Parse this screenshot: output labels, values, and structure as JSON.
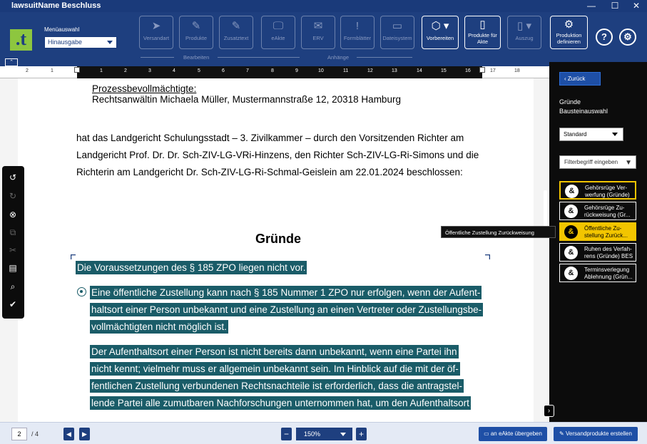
{
  "window": {
    "title": "lawsuitName Beschluss",
    "minimize": "—",
    "maximize": "☐",
    "close": "✕"
  },
  "toolbar": {
    "logo_text": ".t",
    "menu_label": "Menüauswahl",
    "menu_value": "Hinausgabe",
    "buttons": [
      {
        "label": "Versandart",
        "icon": "paper-plane-icon",
        "glyph": "➤",
        "enabled": false
      },
      {
        "label": "Produkte",
        "icon": "edit-icon",
        "glyph": "✎",
        "enabled": false
      },
      {
        "label": "Zusatztext",
        "icon": "text-add-icon",
        "glyph": "✎",
        "enabled": false
      },
      {
        "label": "eAkte",
        "icon": "monitor-icon",
        "glyph": "🖵",
        "enabled": false
      },
      {
        "label": "ERV",
        "icon": "envelope-icon",
        "glyph": "✉",
        "enabled": false
      },
      {
        "label": "Formblätter",
        "icon": "form-icon",
        "glyph": "!",
        "enabled": false
      },
      {
        "label": "Dateisystem",
        "icon": "folder-icon",
        "glyph": "▭",
        "enabled": false
      },
      {
        "label": "Vorbereiten",
        "icon": "box-icon",
        "glyph": "⬡ ▾",
        "enabled": true
      },
      {
        "label": "Produkte für Akte",
        "icon": "document-icon",
        "glyph": "▯",
        "enabled": true
      },
      {
        "label": "Auszug",
        "icon": "document-dropdown-icon",
        "glyph": "▯ ▾",
        "enabled": false
      },
      {
        "label": "Produktion definieren",
        "icon": "satellite-icon",
        "glyph": "⚙",
        "enabled": true
      }
    ],
    "group_edit": "Bearbeiten",
    "group_attach": "Anhänge",
    "help": "?",
    "settings": "⚙",
    "collapse": "⌃"
  },
  "ruler": {
    "ticks_left": [
      "2",
      "1"
    ],
    "ticks": [
      "1",
      "2",
      "3",
      "4",
      "5",
      "6",
      "7",
      "8",
      "9",
      "10",
      "11",
      "12",
      "13",
      "14",
      "15",
      "16"
    ],
    "ticks_right": [
      "17",
      "18"
    ]
  },
  "document": {
    "counsel_heading": "Prozessbevollmächtigte:",
    "counsel_name": "Rechtsanwältin Michaela Müller, Mustermannstraße 12, 20318 Hamburg",
    "body_lines": [
      "hat das Landgericht Schulungsstadt – 3. Zivilkammer – durch den Vorsitzenden Richter am",
      "Landgericht Prof. Dr. Dr. Sch-ZIV-LG-VRi-Hinzens, den Richter Sch-ZIV-LG-Ri-Simons und die",
      "Richterin am Landgericht Dr. Sch-ZIV-LG-Ri-Schmal-Geislein am 22.01.2024 beschlossen:"
    ],
    "section_heading": "Gründe",
    "selected_intro": "Die Voraussetzungen des § 185 ZPO liegen nicht vor.",
    "bullet_lines": [
      "Eine öffentliche Zustellung kann nach § 185 Nummer 1 ZPO nur erfolgen, wenn der Aufent-",
      "haltsort einer Person unbekannt und eine Zustellung an einen Vertreter oder Zustellungsbe-",
      "vollmächtigten nicht möglich ist."
    ],
    "para_lines": [
      "Der Aufenthaltsort einer Person ist nicht bereits dann unbekannt, wenn eine Partei ihn",
      "nicht kennt; vielmehr muss er allgemein unbekannt sein. Im Hinblick auf die mit der öf-",
      "fentlichen Zustellung verbundenen Rechtsnachteile ist erforderlich, dass die antragstel-",
      "lende Partei alle zumutbaren Nachforschungen unternommen hat, um den Aufenthaltsort"
    ]
  },
  "left_tools": [
    {
      "name": "undo-icon",
      "glyph": "↺",
      "enabled": true
    },
    {
      "name": "redo-icon",
      "glyph": "↻",
      "enabled": false
    },
    {
      "name": "remove-block-icon",
      "glyph": "⊗",
      "enabled": true
    },
    {
      "name": "copy-icon",
      "glyph": "⧉",
      "enabled": false
    },
    {
      "name": "cut-icon",
      "glyph": "✂",
      "enabled": false
    },
    {
      "name": "paste-icon",
      "glyph": "▤",
      "enabled": true
    },
    {
      "name": "search-icon",
      "glyph": "⌕",
      "enabled": true
    },
    {
      "name": "check-icon",
      "glyph": "✔",
      "enabled": true
    }
  ],
  "panel": {
    "back": "Zurück",
    "title_line1": "Gründe",
    "title_line2": "Bausteinauswahl",
    "select_value": "Standard",
    "filter_placeholder": "Filterbegriff eingeben",
    "items": [
      {
        "line1": "Gehörsrüge Ver-",
        "line2": "werfung (Gründe)",
        "state": "selected"
      },
      {
        "line1": "Gehörsrüge Zu-",
        "line2": "rückweisung (Gr...",
        "state": "normal"
      },
      {
        "line1": "Öffentliche Zu-",
        "line2": "stellung Zurück...",
        "state": "hover"
      },
      {
        "line1": "Ruhen des Verfah-",
        "line2": "rens (Gründe) BES",
        "state": "normal"
      },
      {
        "line1": "Terminsverlegung",
        "line2": "Ablehnung (Grün...",
        "state": "normal"
      }
    ],
    "item_glyph": "&",
    "tooltip": "Öffentliche Zustellung Zurückweisung (Gründe)",
    "toggle": "›"
  },
  "bottom": {
    "page_current": "2",
    "page_total": "/ 4",
    "prev": "◀",
    "next": "▶",
    "zoom_out": "−",
    "zoom_value": "150%",
    "zoom_in": "+",
    "eakte_button": "an eAkte übergeben",
    "send_button": "Versandprodukte erstellen"
  },
  "colors": {
    "brand": "#1e3f7f",
    "accent_green": "#8dc63f",
    "selection": "#1a5c68",
    "highlight": "#f2c500"
  }
}
